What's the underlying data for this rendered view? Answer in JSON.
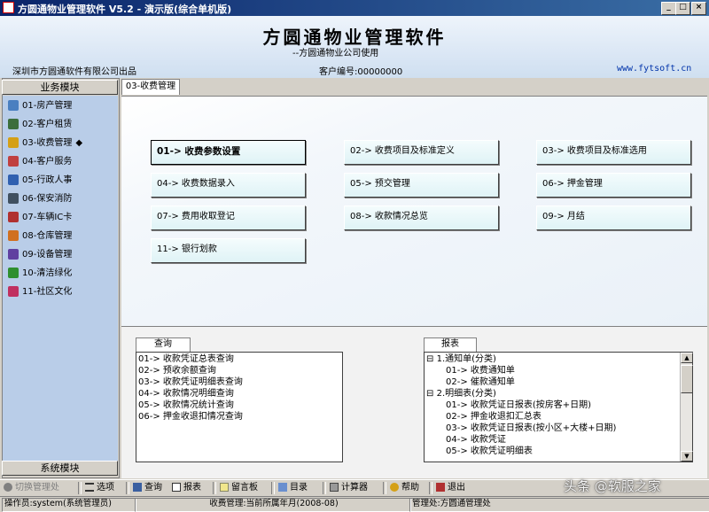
{
  "window": {
    "title": "方圆通物业管理软件 V5.2 - 演示版(综合单机版)",
    "buttons": [
      "_",
      "□",
      "×"
    ]
  },
  "header": {
    "app_title": "方圆通物业管理软件",
    "subtitle": "--方圆通物业公司使用",
    "company": "深圳市方圆通软件有限公司出品",
    "customer": "客户编号:00000000",
    "website": "www.fytsoft.cn"
  },
  "sidebar": {
    "title": "业务模块",
    "items": [
      {
        "label": "01-房产管理",
        "icon": "house-icon",
        "color": "#4a7fc0"
      },
      {
        "label": "02-客户租赁",
        "icon": "people-icon",
        "color": "#3c6e3c"
      },
      {
        "label": "03-收费管理",
        "icon": "coins-icon",
        "color": "#d4a017",
        "active_mark": "◆"
      },
      {
        "label": "04-客户服务",
        "icon": "wrench-icon",
        "color": "#c04040"
      },
      {
        "label": "05-行政人事",
        "icon": "calendar-icon",
        "color": "#3060b0"
      },
      {
        "label": "06-保安消防",
        "icon": "guard-icon",
        "color": "#405060"
      },
      {
        "label": "07-车辆IC卡",
        "icon": "car-icon",
        "color": "#b03030"
      },
      {
        "label": "08-仓库管理",
        "icon": "warehouse-icon",
        "color": "#d07020"
      },
      {
        "label": "09-设备管理",
        "icon": "device-icon",
        "color": "#6040a0"
      },
      {
        "label": "10-清洁绿化",
        "icon": "tree-icon",
        "color": "#2f8f2f"
      },
      {
        "label": "11-社区文化",
        "icon": "book-icon",
        "color": "#c03060"
      }
    ],
    "system_module": "系统模块"
  },
  "main": {
    "tab": "03-收费管理",
    "functions": [
      {
        "label": "01-> 收费参数设置",
        "bold": true
      },
      {
        "label": "02-> 收费项目及标准定义"
      },
      {
        "label": "03-> 收费项目及标准选用"
      },
      {
        "label": "04-> 收费数据录入"
      },
      {
        "label": "05-> 预交管理"
      },
      {
        "label": "06-> 押金管理"
      },
      {
        "label": "07-> 费用收取登记"
      },
      {
        "label": "08-> 收款情况总览"
      },
      {
        "label": "09-> 月结"
      },
      {
        "label": "11-> 银行划款"
      }
    ]
  },
  "query": {
    "title": "查询",
    "items": [
      "01-> 收款凭证总表查询",
      "02-> 预收余额查询",
      "03-> 收款凭证明细表查询",
      "04-> 收款情况明细查询",
      "05-> 收款情况统计查询",
      "06-> 押金收退扣情况查询"
    ]
  },
  "report": {
    "title": "报表",
    "tree": [
      {
        "text": "1.通知单(分类)",
        "level": 0,
        "toggle": "⊟"
      },
      {
        "text": "01-> 收费通知单",
        "level": 1
      },
      {
        "text": "02-> 催款通知单",
        "level": 1
      },
      {
        "text": "2.明细表(分类)",
        "level": 0,
        "toggle": "⊟"
      },
      {
        "text": "01-> 收款凭证日报表(按房客+日期)",
        "level": 1
      },
      {
        "text": "02-> 押金收退扣汇总表",
        "level": 1
      },
      {
        "text": "03-> 收款凭证日报表(按小区+大楼+日期)",
        "level": 1
      },
      {
        "text": "04-> 收款凭证",
        "level": 1
      },
      {
        "text": "05-> 收款凭证明细表",
        "level": 1
      }
    ]
  },
  "toolbar": {
    "items": [
      {
        "label": "切换管理处",
        "icon": "switch-icon"
      },
      {
        "label": "选项",
        "icon": "list-icon"
      },
      {
        "label": "查询",
        "icon": "query-icon"
      },
      {
        "label": "报表",
        "icon": "report-icon"
      },
      {
        "label": "留言板",
        "icon": "message-icon"
      },
      {
        "label": "目录",
        "icon": "catalog-icon"
      },
      {
        "label": "计算器",
        "icon": "calculator-icon"
      },
      {
        "label": "帮助",
        "icon": "help-icon"
      },
      {
        "label": "退出",
        "icon": "exit-icon"
      }
    ]
  },
  "status": {
    "operator": "操作员:system(系统管理员)",
    "period": "收费管理:当前所属年月(2008-08)",
    "office": "管理处:方圆通管理处"
  },
  "watermark": "头条 @软服之家"
}
